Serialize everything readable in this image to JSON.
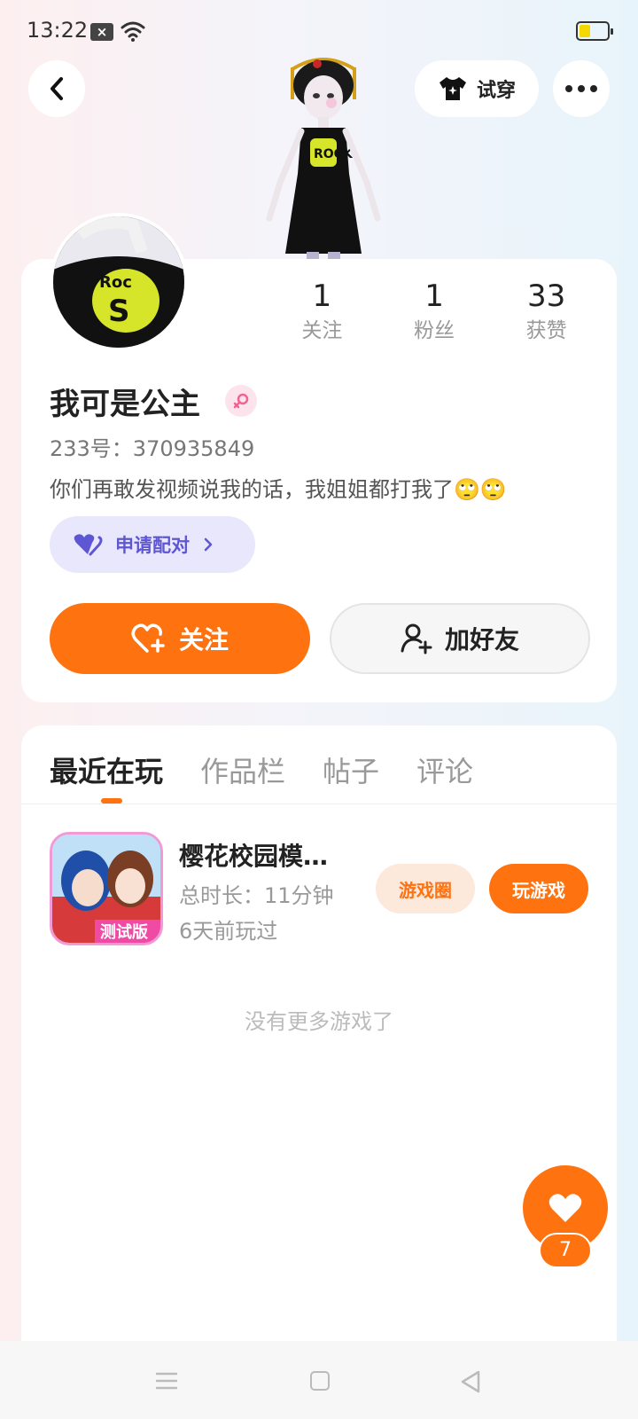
{
  "status_bar": {
    "time": "13:22"
  },
  "header": {
    "try_on_label": "试穿"
  },
  "profile": {
    "stats": [
      {
        "value": "1",
        "label": "关注"
      },
      {
        "value": "1",
        "label": "粉丝"
      },
      {
        "value": "33",
        "label": "获赞"
      }
    ],
    "nickname": "我可是公主",
    "user_id": "233号：370935849",
    "bio": "你们再敢发视频说我的话，我姐姐都打我了🙄🙄",
    "pair_label": "申请配对",
    "follow_label": "关注",
    "add_friend_label": "加好友"
  },
  "tabs": [
    "最近在玩",
    "作品栏",
    "帖子",
    "评论"
  ],
  "games": [
    {
      "title": "樱花校园模…",
      "duration": "总时长：11分钟",
      "last_played": "6天前玩过",
      "icon_badge": "测试版",
      "circle_label": "游戏圈",
      "play_label": "玩游戏"
    }
  ],
  "no_more_text": "没有更多游戏了",
  "like": {
    "count": "7"
  },
  "colors": {
    "accent": "#ff7210",
    "pair": "#5e56d2",
    "gender": "#f06292"
  }
}
